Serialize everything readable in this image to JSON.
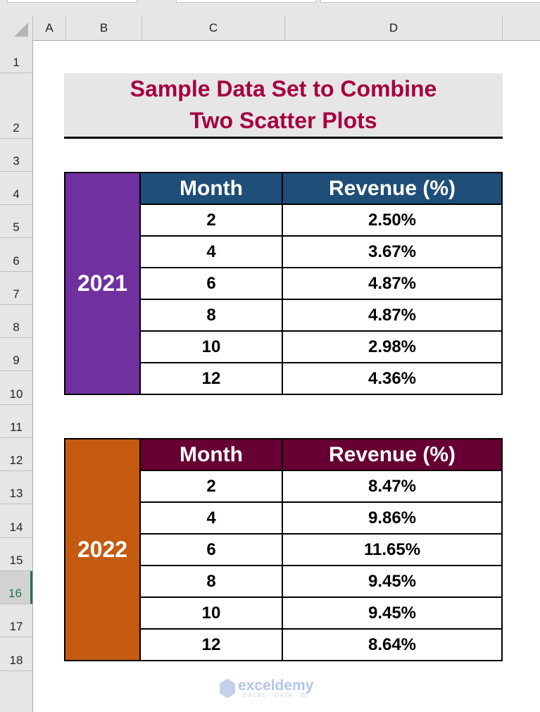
{
  "columns": [
    "A",
    "B",
    "C",
    "D"
  ],
  "rows": [
    "1",
    "2",
    "3",
    "4",
    "5",
    "6",
    "7",
    "8",
    "9",
    "10",
    "11",
    "12",
    "13",
    "14",
    "15",
    "16",
    "17",
    "18"
  ],
  "selected_row": "16",
  "title": {
    "line1": "Sample Data Set to Combine",
    "line2": "Two Scatter Plots"
  },
  "colors": {
    "title_text": "#a50040",
    "title_bg": "#e7e6e6",
    "year2021_bg": "#7030a0",
    "header2021_bg": "#1f4e78",
    "year2022_bg": "#c55a11",
    "header2022_bg": "#660033"
  },
  "table2021": {
    "year": "2021",
    "headers": [
      "Month",
      "Revenue (%)"
    ],
    "rows": [
      [
        "2",
        "2.50%"
      ],
      [
        "4",
        "3.67%"
      ],
      [
        "6",
        "4.87%"
      ],
      [
        "8",
        "4.87%"
      ],
      [
        "10",
        "2.98%"
      ],
      [
        "12",
        "4.36%"
      ]
    ]
  },
  "table2022": {
    "year": "2022",
    "headers": [
      "Month",
      "Revenue (%)"
    ],
    "rows": [
      [
        "2",
        "8.47%"
      ],
      [
        "4",
        "9.86%"
      ],
      [
        "6",
        "11.65%"
      ],
      [
        "8",
        "9.45%"
      ],
      [
        "10",
        "9.45%"
      ],
      [
        "12",
        "8.64%"
      ]
    ]
  },
  "watermark": {
    "name": "exceldemy",
    "tagline": "EXCEL · DATA · BI"
  }
}
